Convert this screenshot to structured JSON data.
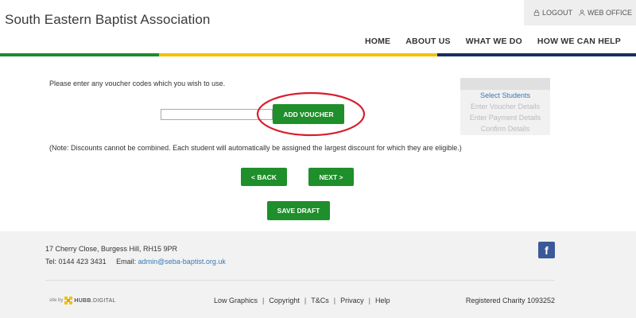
{
  "header": {
    "site_title": "South Eastern Baptist Association",
    "logout_label": "LOGOUT",
    "web_office_label": "WEB OFFICE"
  },
  "nav": {
    "items": [
      "HOME",
      "ABOUT US",
      "WHAT WE DO",
      "HOW WE CAN HELP"
    ]
  },
  "colors": {
    "stripe": [
      "#1f8a2e",
      "#f2c200",
      "#1b2d5e"
    ],
    "button_green": "#1e8f2a",
    "highlight_red": "#d81e2a",
    "link_blue": "#3a78b5"
  },
  "voucher": {
    "intro_text": "Please enter any voucher codes which you wish to use.",
    "input_value": "",
    "add_button_label": "ADD VOUCHER",
    "note_text": "(Note: Discounts cannot be combined. Each student will automatically be assigned the largest discount for which they are eligible.)"
  },
  "steps": {
    "items": [
      "Select Students",
      "Enter Voucher Details",
      "Enter Payment Details",
      "Confirm Details"
    ]
  },
  "actions": {
    "back_label": "< BACK",
    "next_label": "NEXT >",
    "save_draft_label": "SAVE DRAFT"
  },
  "footer": {
    "address": "17 Cherry Close, Burgess Hill, RH15 9PR",
    "tel_label": "Tel:",
    "tel": "0144 423 3431",
    "email_label": "Email:",
    "email": "admin@seba-baptist.org.uk",
    "facebook_glyph": "f",
    "site_by": "site by",
    "hubb_brand": "HUBB",
    "hubb_suffix": ".DIGITAL",
    "links": [
      "Low Graphics",
      "Copyright",
      "T&Cs",
      "Privacy",
      "Help"
    ],
    "charity": "Registered Charity 1093252"
  }
}
